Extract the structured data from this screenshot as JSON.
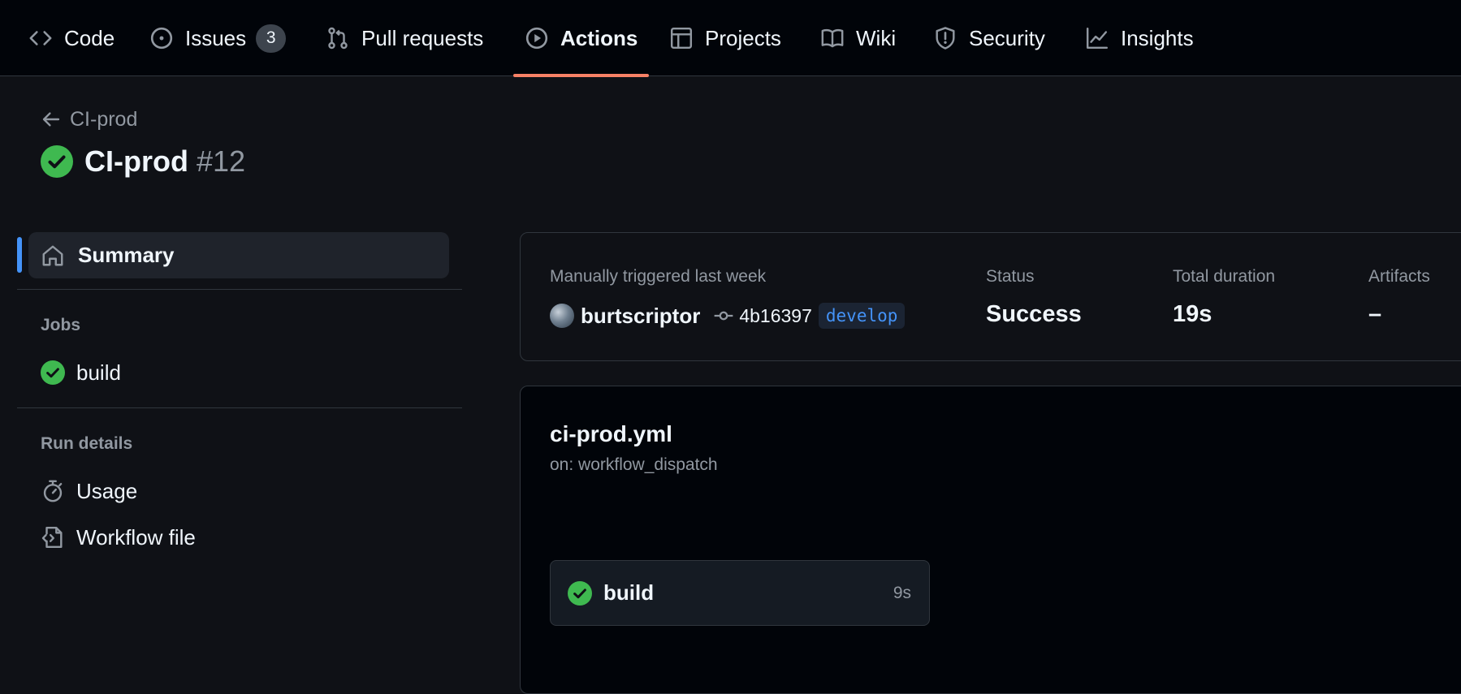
{
  "nav": {
    "tabs": [
      {
        "label": "Code",
        "icon": "code-icon"
      },
      {
        "label": "Issues",
        "icon": "issue-opened-icon",
        "count": "3"
      },
      {
        "label": "Pull requests",
        "icon": "git-pull-request-icon"
      },
      {
        "label": "Actions",
        "icon": "play-icon",
        "active": true
      },
      {
        "label": "Projects",
        "icon": "table-icon"
      },
      {
        "label": "Wiki",
        "icon": "book-icon"
      },
      {
        "label": "Security",
        "icon": "shield-icon"
      },
      {
        "label": "Insights",
        "icon": "graph-icon"
      }
    ],
    "active_underline_color": "#f78166"
  },
  "header": {
    "back_label": "CI-prod",
    "title": "CI-prod",
    "run_number": "#12",
    "status_icon": "check-circle-fill-icon"
  },
  "sidebar": {
    "summary_label": "Summary",
    "jobs_heading": "Jobs",
    "jobs": [
      {
        "label": "build",
        "status_icon": "check-circle-fill-icon"
      }
    ],
    "run_details_heading": "Run details",
    "run_details": [
      {
        "label": "Usage",
        "icon": "stopwatch-icon"
      },
      {
        "label": "Workflow file",
        "icon": "file-code-icon"
      }
    ]
  },
  "summary": {
    "trigger_text": "Manually triggered last week",
    "actor": "burtscriptor",
    "commit_sha": "4b16397",
    "branch": "develop",
    "status_label": "Status",
    "status_value": "Success",
    "duration_label": "Total duration",
    "duration_value": "19s",
    "artifacts_label": "Artifacts",
    "artifacts_value": "–"
  },
  "workflow": {
    "file_name": "ci-prod.yml",
    "trigger": "on: workflow_dispatch",
    "jobs": [
      {
        "name": "build",
        "duration": "9s",
        "status_icon": "check-circle-fill-icon"
      }
    ]
  },
  "colors": {
    "success": "#3fb950",
    "accent_blue": "#4493f8",
    "page_bg": "#0f1116",
    "nav_bg": "#010409"
  }
}
